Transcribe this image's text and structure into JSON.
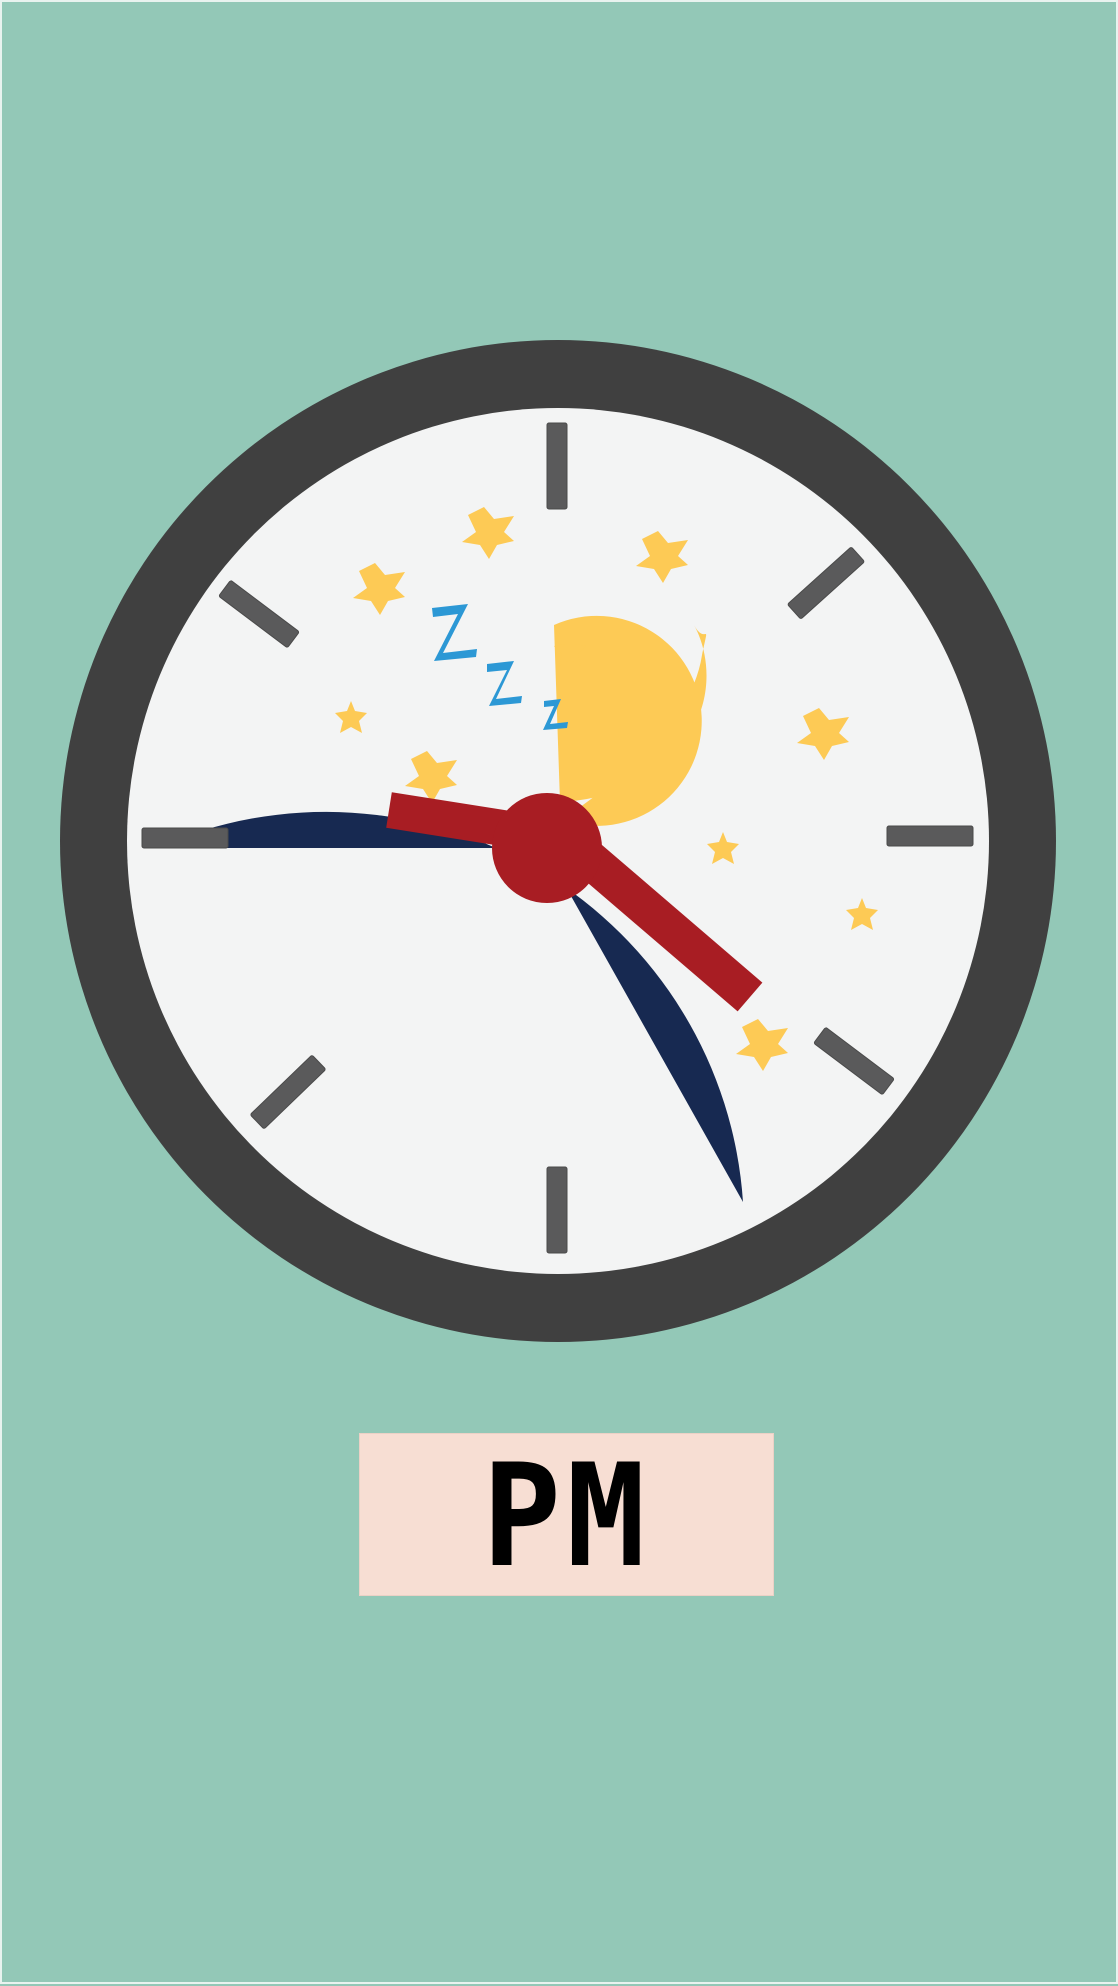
{
  "illustration": {
    "icons": {
      "clock": "wall-clock-icon",
      "moon": "crescent-moon-icon",
      "stars": "star-icon",
      "sleep": "sleep-zzz-icon"
    },
    "colors": {
      "page_background": "#93c8b7",
      "clock_frame": "#404040",
      "clock_face": "#f3f4f4",
      "night_sky": "#172951",
      "moon_and_stars": "#fdca55",
      "sleep_symbol": "#2c98d5",
      "clock_hands": "#a81d23",
      "tick_marks": "#5a5a5b",
      "label_background": "#f7ded3",
      "label_text": "#000000"
    }
  },
  "label": {
    "text": "PM"
  }
}
